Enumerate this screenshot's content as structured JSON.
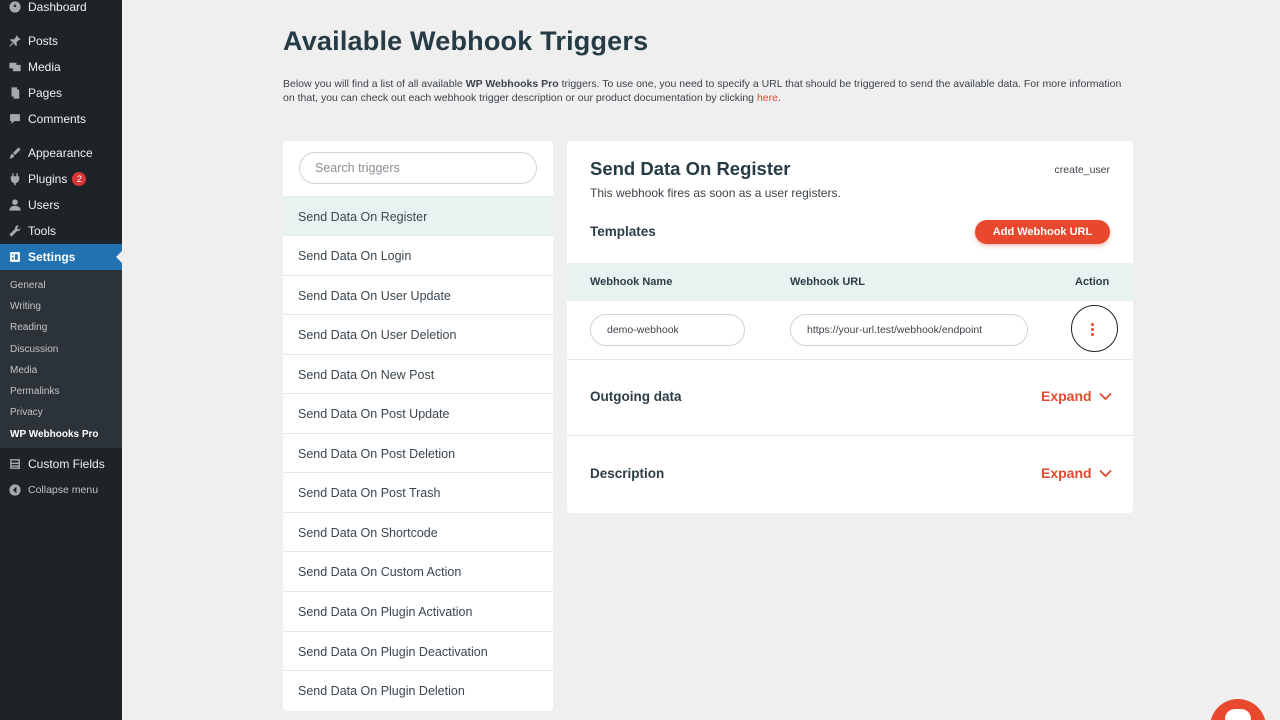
{
  "sidebar": {
    "items": [
      {
        "label": "Dashboard",
        "icon": "dashboard-icon"
      },
      {
        "label": "Posts",
        "icon": "pin-icon"
      },
      {
        "label": "Media",
        "icon": "media-icon"
      },
      {
        "label": "Pages",
        "icon": "pages-icon"
      },
      {
        "label": "Comments",
        "icon": "comment-icon"
      },
      {
        "label": "Appearance",
        "icon": "brush-icon"
      },
      {
        "label": "Plugins",
        "icon": "plugin-icon",
        "badge": "2"
      },
      {
        "label": "Users",
        "icon": "user-icon"
      },
      {
        "label": "Tools",
        "icon": "wrench-icon"
      },
      {
        "label": "Settings",
        "icon": "settings-icon"
      }
    ],
    "submenu": [
      "General",
      "Writing",
      "Reading",
      "Discussion",
      "Media",
      "Permalinks",
      "Privacy",
      "WP Webhooks Pro"
    ],
    "custom_fields": "Custom Fields",
    "collapse": "Collapse menu"
  },
  "page": {
    "title": "Available Webhook Triggers",
    "intro_1": "Below you will find a list of all available ",
    "intro_bold": "WP Webhooks Pro",
    "intro_2": " triggers. To use one, you need to specify a URL that should be triggered to send the available data. For more information on that, you can check out each webhook trigger description or our product documentation by clicking ",
    "intro_link": "here",
    "intro_end": "."
  },
  "search": {
    "placeholder": "Search triggers"
  },
  "triggers": [
    "Send Data On Register",
    "Send Data On Login",
    "Send Data On User Update",
    "Send Data On User Deletion",
    "Send Data On New Post",
    "Send Data On Post Update",
    "Send Data On Post Deletion",
    "Send Data On Post Trash",
    "Send Data On Shortcode",
    "Send Data On Custom Action",
    "Send Data On Plugin Activation",
    "Send Data On Plugin Deactivation",
    "Send Data On Plugin Deletion"
  ],
  "detail": {
    "title": "Send Data On Register",
    "slug": "create_user",
    "description": "This webhook fires as soon as a user registers.",
    "templates_label": "Templates",
    "add_button": "Add Webhook URL",
    "columns": {
      "name": "Webhook Name",
      "url": "Webhook URL",
      "action": "Action"
    },
    "row": {
      "name": "demo-webhook",
      "url": "https://your-url.test/webhook/endpoint"
    },
    "sections": [
      {
        "label": "Outgoing data",
        "toggle": "Expand"
      },
      {
        "label": "Description",
        "toggle": "Expand"
      }
    ]
  },
  "colors": {
    "accent": "#e8492e",
    "sidebar": "#1d2327",
    "active": "#2271b1",
    "selected_row": "#e8f3f1"
  }
}
